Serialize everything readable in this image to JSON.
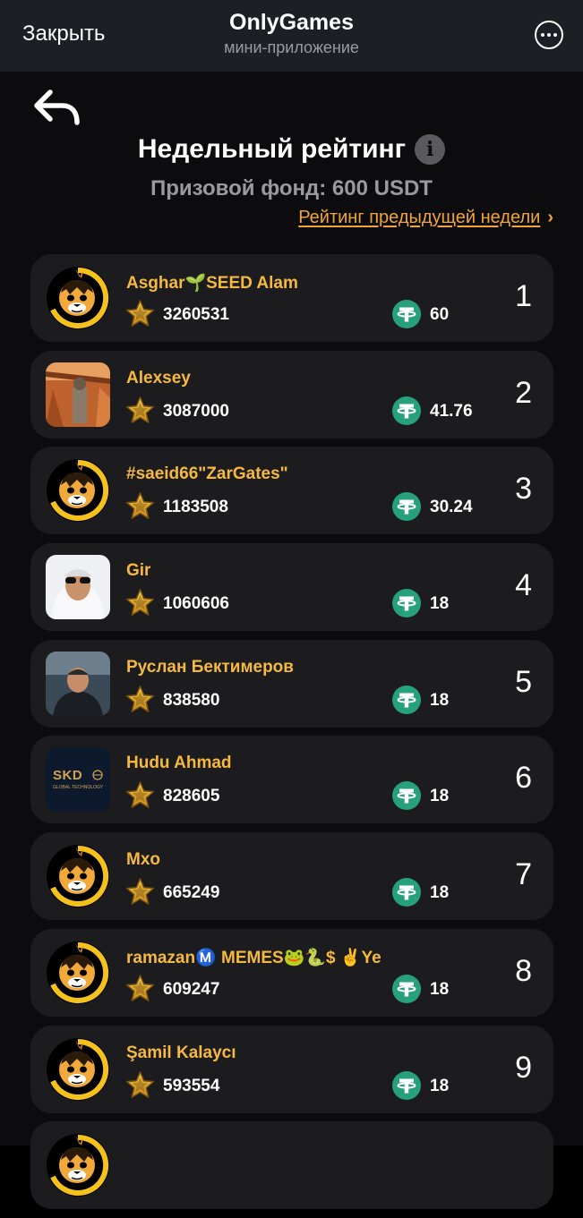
{
  "header": {
    "close_label": "Закрыть",
    "app_title": "OnlyGames",
    "app_subtitle": "мини-приложение"
  },
  "page": {
    "title": "Недельный рейтинг",
    "info_symbol": "i",
    "prize_pool": "Призовой фонд: 600 USDT",
    "prev_week_link": "Рейтинг предыдущей недели",
    "prev_week_chevron": "›"
  },
  "colors": {
    "accent_orange": "#f0a43a",
    "name_gold": "#f5b941",
    "tether_green": "#26a17b",
    "card_bg": "#1c1c1e"
  },
  "leaderboard": [
    {
      "rank": "1",
      "name": "Asghar🌱SEED Alam",
      "score": "3260531",
      "reward": "60",
      "avatar": "lion-logo"
    },
    {
      "rank": "2",
      "name": "Alexsey",
      "score": "3087000",
      "reward": "41.76",
      "avatar": "photo-warm"
    },
    {
      "rank": "3",
      "name": "#saeid66\"ZarGates\"",
      "score": "1183508",
      "reward": "30.24",
      "avatar": "lion-logo"
    },
    {
      "rank": "4",
      "name": "Gir",
      "score": "1060606",
      "reward": "18",
      "avatar": "photo-light"
    },
    {
      "rank": "5",
      "name": "Руслан Бектимеров",
      "score": "838580",
      "reward": "18",
      "avatar": "photo-dark"
    },
    {
      "rank": "6",
      "name": "Hudu Ahmad",
      "score": "828605",
      "reward": "18",
      "avatar": "skd-logo"
    },
    {
      "rank": "7",
      "name": "Mxo",
      "score": "665249",
      "reward": "18",
      "avatar": "lion-logo"
    },
    {
      "rank": "8",
      "name": "ramazanⓂ️ MEMES🐸🐍$ ✌️Ye",
      "score": "609247",
      "reward": "18",
      "avatar": "lion-logo"
    },
    {
      "rank": "9",
      "name": "Şamil Kalaycı",
      "score": "593554",
      "reward": "18",
      "avatar": "lion-logo"
    }
  ],
  "skd_logo": {
    "wordmark": "SKD",
    "tagline": "GLOBAL TECHNOLOGY"
  }
}
